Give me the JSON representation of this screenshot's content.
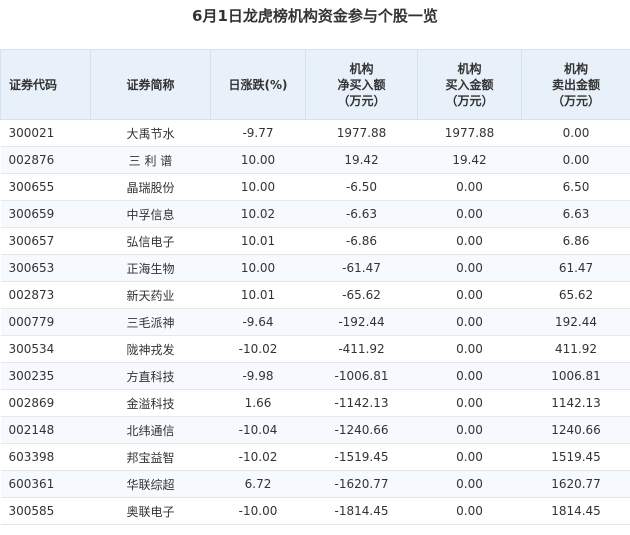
{
  "title": "6月1日龙虎榜机构资金参与个股一览",
  "headers": {
    "code": "证券代码",
    "name": "证券简称",
    "change": "日涨跌(%)",
    "net_buy": [
      "机构",
      "净买入额",
      "（万元）"
    ],
    "buy": [
      "机构",
      "买入金额",
      "（万元）"
    ],
    "sell": [
      "机构",
      "卖出金额",
      "（万元）"
    ]
  },
  "rows": [
    {
      "code": "300021",
      "name": "大禹节水",
      "change": "-9.77",
      "net_buy": "1977.88",
      "buy": "1977.88",
      "sell": "0.00"
    },
    {
      "code": "002876",
      "name": "三 利 谱",
      "change": "10.00",
      "net_buy": "19.42",
      "buy": "19.42",
      "sell": "0.00"
    },
    {
      "code": "300655",
      "name": "晶瑞股份",
      "change": "10.00",
      "net_buy": "-6.50",
      "buy": "0.00",
      "sell": "6.50"
    },
    {
      "code": "300659",
      "name": "中孚信息",
      "change": "10.02",
      "net_buy": "-6.63",
      "buy": "0.00",
      "sell": "6.63"
    },
    {
      "code": "300657",
      "name": "弘信电子",
      "change": "10.01",
      "net_buy": "-6.86",
      "buy": "0.00",
      "sell": "6.86"
    },
    {
      "code": "300653",
      "name": "正海生物",
      "change": "10.00",
      "net_buy": "-61.47",
      "buy": "0.00",
      "sell": "61.47"
    },
    {
      "code": "002873",
      "name": "新天药业",
      "change": "10.01",
      "net_buy": "-65.62",
      "buy": "0.00",
      "sell": "65.62"
    },
    {
      "code": "000779",
      "name": "三毛派神",
      "change": "-9.64",
      "net_buy": "-192.44",
      "buy": "0.00",
      "sell": "192.44"
    },
    {
      "code": "300534",
      "name": "陇神戎发",
      "change": "-10.02",
      "net_buy": "-411.92",
      "buy": "0.00",
      "sell": "411.92"
    },
    {
      "code": "300235",
      "name": "方直科技",
      "change": "-9.98",
      "net_buy": "-1006.81",
      "buy": "0.00",
      "sell": "1006.81"
    },
    {
      "code": "002869",
      "name": "金溢科技",
      "change": "1.66",
      "net_buy": "-1142.13",
      "buy": "0.00",
      "sell": "1142.13"
    },
    {
      "code": "002148",
      "name": "北纬通信",
      "change": "-10.04",
      "net_buy": "-1240.66",
      "buy": "0.00",
      "sell": "1240.66"
    },
    {
      "code": "603398",
      "name": "邦宝益智",
      "change": "-10.02",
      "net_buy": "-1519.45",
      "buy": "0.00",
      "sell": "1519.45"
    },
    {
      "code": "600361",
      "name": "华联综超",
      "change": "6.72",
      "net_buy": "-1620.77",
      "buy": "0.00",
      "sell": "1620.77"
    },
    {
      "code": "300585",
      "name": "奥联电子",
      "change": "-10.00",
      "net_buy": "-1814.45",
      "buy": "0.00",
      "sell": "1814.45"
    }
  ]
}
